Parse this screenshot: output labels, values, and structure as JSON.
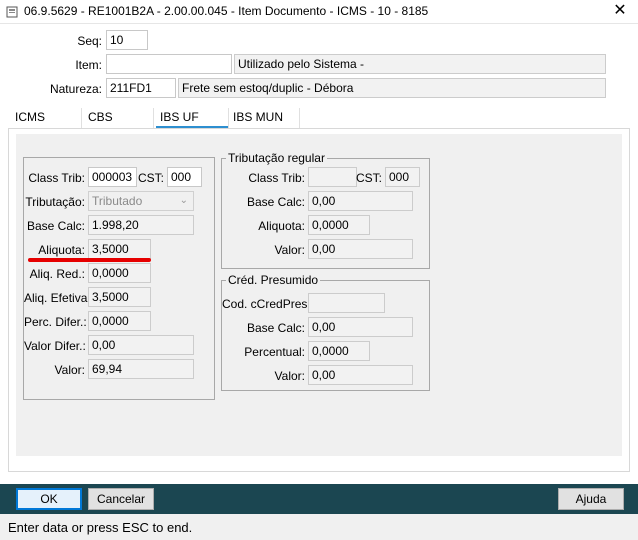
{
  "window": {
    "title": "06.9.5629 - RE1001B2A - 2.00.00.045 - Item Documento - ICMS - 10 - 8185",
    "close_glyph": "✕"
  },
  "header": {
    "seq_label": "Seq:",
    "seq_value": "10",
    "item_label": "Item:",
    "item_value": "",
    "item_desc": "Utilizado pelo Sistema -",
    "natureza_label": "Natureza:",
    "natureza_value": "211FD1",
    "natureza_desc": "Frete sem estoq/duplic - Débora"
  },
  "tabs": [
    {
      "label": "ICMS",
      "active": false
    },
    {
      "label": "CBS",
      "active": false
    },
    {
      "label": "IBS UF",
      "active": true
    },
    {
      "label": "IBS MUN",
      "active": false
    }
  ],
  "left_group": {
    "class_trib_label": "Class Trib:",
    "class_trib_value": "000003",
    "cst_label": "CST:",
    "cst_value": "000",
    "tributacao_label": "Tributação:",
    "tributacao_value": "Tributado",
    "base_calc_label": "Base Calc:",
    "base_calc_value": "1.998,20",
    "aliquota_label": "Aliquota:",
    "aliquota_value": "3,5000",
    "aliq_red_label": "Aliq. Red.:",
    "aliq_red_value": "0,0000",
    "aliq_efetiva_label": "Aliq. Efetiva:",
    "aliq_efetiva_value": "3,5000",
    "perc_difer_label": "Perc. Difer.:",
    "perc_difer_value": "0,0000",
    "valor_difer_label": "Valor Difer.:",
    "valor_difer_value": "0,00",
    "valor_label": "Valor:",
    "valor_value": "69,94"
  },
  "trib_regular": {
    "title": "Tributação regular",
    "class_trib_label": "Class Trib:",
    "class_trib_value": "",
    "cst_label": "CST:",
    "cst_value": "000",
    "base_calc_label": "Base Calc:",
    "base_calc_value": "0,00",
    "aliquota_label": "Aliquota:",
    "aliquota_value": "0,0000",
    "valor_label": "Valor:",
    "valor_value": "0,00"
  },
  "cred_presumido": {
    "title": "Créd. Presumido",
    "cod_label": "Cod. cCredPres:",
    "cod_value": "",
    "base_calc_label": "Base Calc:",
    "base_calc_value": "0,00",
    "percentual_label": "Percentual:",
    "percentual_value": "0,0000",
    "valor_label": "Valor:",
    "valor_value": "0,00"
  },
  "buttons": {
    "ok": "OK",
    "cancel": "Cancelar",
    "help": "Ajuda"
  },
  "status": {
    "text": "Enter data or press ESC to end."
  },
  "colors": {
    "accent": "#2d8fd0",
    "bottom_bar": "#1b4651",
    "highlight": "#e60000"
  },
  "icons": {
    "app": "app-icon",
    "close": "close-icon",
    "dropdown": "chevron-down-icon"
  }
}
